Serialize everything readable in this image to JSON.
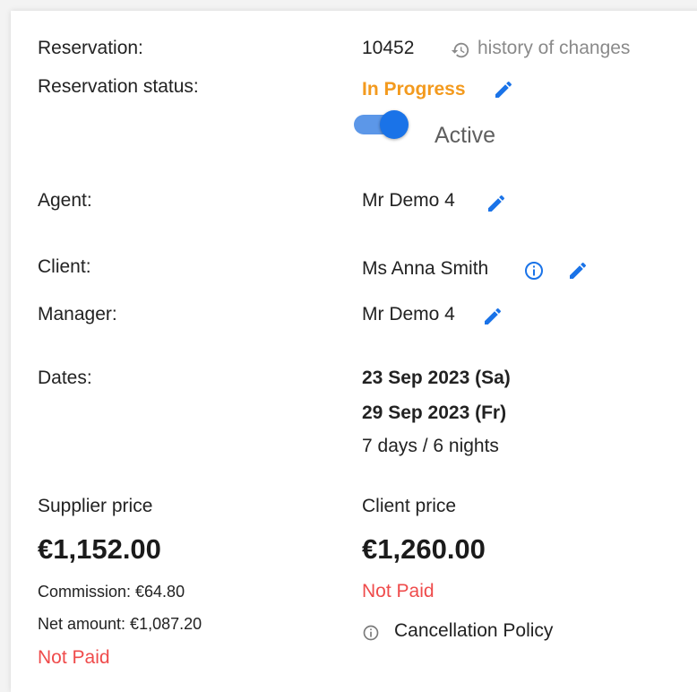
{
  "reservation": {
    "label": "Reservation:",
    "number": "10452",
    "history_link": "history of changes",
    "status_label": "Reservation status:",
    "status_value": "In Progress",
    "active_toggle_on": true,
    "active_label": "Active"
  },
  "agent": {
    "label": "Agent:",
    "value": "Mr Demo 4"
  },
  "client": {
    "label": "Client:",
    "value": "Ms Anna Smith"
  },
  "manager": {
    "label": "Manager:",
    "value": "Mr Demo 4"
  },
  "dates": {
    "label": "Dates:",
    "start": "23 Sep 2023 (Sa)",
    "end": "29 Sep 2023 (Fr)",
    "duration": "7 days / 6 nights"
  },
  "supplier_price": {
    "label": "Supplier price",
    "amount": "€1,152.00",
    "commission": "Commission: €64.80",
    "net_amount": "Net amount: €1,087.20",
    "payment_status": "Not Paid"
  },
  "client_price": {
    "label": "Client price",
    "amount": "€1,260.00",
    "payment_status": "Not Paid",
    "cancellation_policy": "Cancellation Policy"
  },
  "colors": {
    "accent_blue": "#1a73e8",
    "status_orange": "#f39a1e",
    "unpaid_red": "#ef4b4b"
  }
}
